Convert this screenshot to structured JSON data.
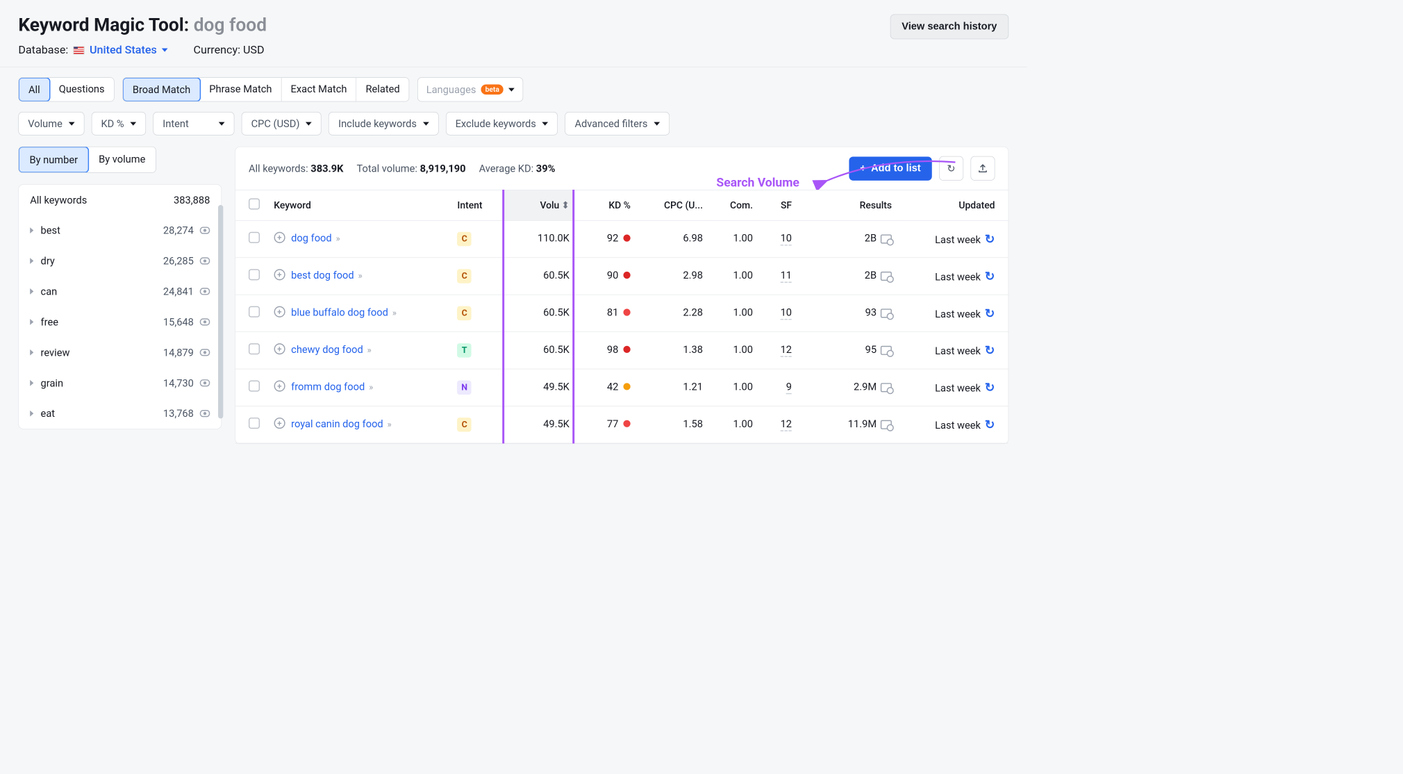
{
  "header": {
    "title_prefix": "Keyword Magic Tool:",
    "query": "dog food",
    "history_btn": "View search history",
    "database_label": "Database:",
    "country": "United States",
    "currency_label": "Currency: USD"
  },
  "type_tabs": {
    "all": "All",
    "questions": "Questions"
  },
  "match_tabs": {
    "broad": "Broad Match",
    "phrase": "Phrase Match",
    "exact": "Exact Match",
    "related": "Related"
  },
  "lang_dd": {
    "label": "Languages",
    "badge": "beta"
  },
  "filters": {
    "volume": "Volume",
    "kd": "KD %",
    "intent": "Intent",
    "cpc": "CPC (USD)",
    "include": "Include keywords",
    "exclude": "Exclude keywords",
    "advanced": "Advanced filters"
  },
  "side_seg": {
    "by_number": "By number",
    "by_volume": "By volume"
  },
  "sidebar": {
    "head_label": "All keywords",
    "head_count": "383,888",
    "items": [
      {
        "label": "best",
        "count": "28,274"
      },
      {
        "label": "dry",
        "count": "26,285"
      },
      {
        "label": "can",
        "count": "24,841"
      },
      {
        "label": "free",
        "count": "15,648"
      },
      {
        "label": "review",
        "count": "14,879"
      },
      {
        "label": "grain",
        "count": "14,730"
      },
      {
        "label": "eat",
        "count": "13,768"
      }
    ]
  },
  "stats": {
    "all_kw_label": "All keywords:",
    "all_kw": "383.9K",
    "total_vol_label": "Total volume:",
    "total_vol": "8,919,190",
    "avg_kd_label": "Average KD:",
    "avg_kd": "39%",
    "add_btn": "Add to list"
  },
  "annotation": "Search Volume",
  "columns": {
    "keyword": "Keyword",
    "intent": "Intent",
    "volume": "Volu",
    "kd": "KD %",
    "cpc": "CPC (U...",
    "com": "Com.",
    "sf": "SF",
    "results": "Results",
    "updated": "Updated"
  },
  "rows": [
    {
      "kw": "dog food",
      "intent": "C",
      "vol": "110.0K",
      "kd": "92",
      "kdclr": "dot-red",
      "cpc": "6.98",
      "com": "1.00",
      "sf": "10",
      "res": "2B",
      "upd": "Last week"
    },
    {
      "kw": "best dog food",
      "intent": "C",
      "vol": "60.5K",
      "kd": "90",
      "kdclr": "dot-red",
      "cpc": "2.98",
      "com": "1.00",
      "sf": "11",
      "res": "2B",
      "upd": "Last week"
    },
    {
      "kw": "blue buffalo dog food",
      "intent": "C",
      "vol": "60.5K",
      "kd": "81",
      "kdclr": "dot-lred",
      "cpc": "2.28",
      "com": "1.00",
      "sf": "10",
      "res": "93",
      "upd": "Last week"
    },
    {
      "kw": "chewy dog food",
      "intent": "T",
      "vol": "60.5K",
      "kd": "98",
      "kdclr": "dot-red",
      "cpc": "1.38",
      "com": "1.00",
      "sf": "12",
      "res": "95",
      "upd": "Last week"
    },
    {
      "kw": "fromm dog food",
      "intent": "N",
      "vol": "49.5K",
      "kd": "42",
      "kdclr": "dot-yellow",
      "cpc": "1.21",
      "com": "1.00",
      "sf": "9",
      "res": "2.9M",
      "upd": "Last week"
    },
    {
      "kw": "royal canin dog food",
      "intent": "C",
      "vol": "49.5K",
      "kd": "77",
      "kdclr": "dot-lred",
      "cpc": "1.58",
      "com": "1.00",
      "sf": "12",
      "res": "11.9M",
      "upd": "Last week"
    }
  ]
}
